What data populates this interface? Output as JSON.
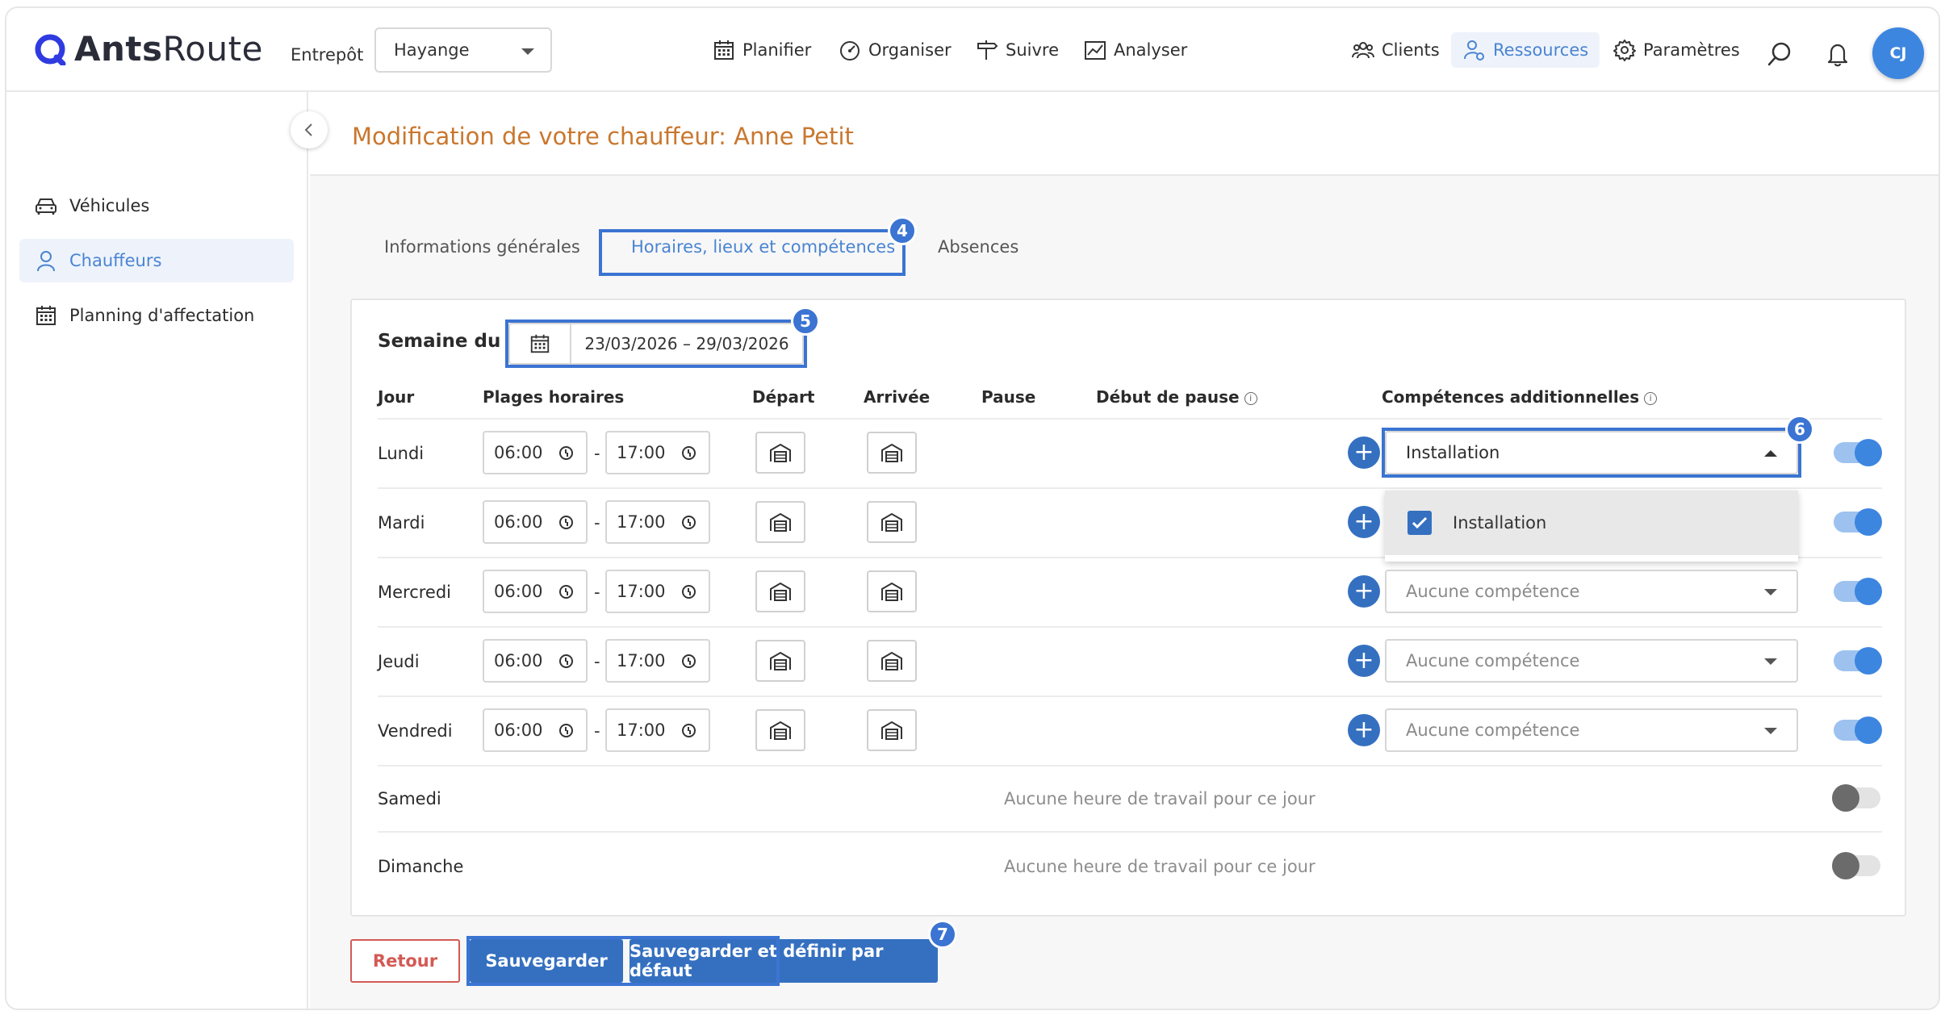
{
  "brand": {
    "name_bold": "Ants",
    "name_light": "Route"
  },
  "header": {
    "warehouse_label": "Entrepôt",
    "warehouse_value": "Hayange",
    "nav": [
      {
        "label": "Planifier",
        "icon": "calendar-icon"
      },
      {
        "label": "Organiser",
        "icon": "gauge-icon"
      },
      {
        "label": "Suivre",
        "icon": "signpost-icon"
      },
      {
        "label": "Analyser",
        "icon": "chart-icon"
      }
    ],
    "right_nav": [
      {
        "label": "Clients",
        "icon": "clients-icon"
      },
      {
        "label": "Ressources",
        "icon": "resources-icon",
        "active": true
      },
      {
        "label": "Paramètres",
        "icon": "gear-icon"
      }
    ],
    "avatar_initials": "CJ"
  },
  "sidebar": {
    "items": [
      {
        "label": "Véhicules",
        "icon": "car-icon"
      },
      {
        "label": "Chauffeurs",
        "icon": "person-icon",
        "active": true
      },
      {
        "label": "Planning d'affectation",
        "icon": "calendar-icon"
      }
    ]
  },
  "page": {
    "title": "Modification de votre chauffeur: Anne Petit",
    "tabs": [
      {
        "label": "Informations générales"
      },
      {
        "label": "Horaires, lieux et compétences",
        "active": true
      },
      {
        "label": "Absences"
      }
    ]
  },
  "schedule": {
    "week_label": "Semaine du",
    "week_range": "23/03/2026 – 29/03/2026",
    "columns": {
      "day": "Jour",
      "ranges": "Plages horaires",
      "departure": "Départ",
      "arrival": "Arrivée",
      "pause": "Pause",
      "pause_start": "Début de pause",
      "skills": "Compétences additionnelles"
    },
    "days": [
      {
        "name": "Lundi",
        "start": "06:00",
        "end": "17:00",
        "skill": "Installation",
        "enabled": true
      },
      {
        "name": "Mardi",
        "start": "06:00",
        "end": "17:00",
        "skill": "",
        "enabled": true
      },
      {
        "name": "Mercredi",
        "start": "06:00",
        "end": "17:00",
        "skill": "Aucune compétence",
        "enabled": true
      },
      {
        "name": "Jeudi",
        "start": "06:00",
        "end": "17:00",
        "skill": "Aucune compétence",
        "enabled": true
      },
      {
        "name": "Vendredi",
        "start": "06:00",
        "end": "17:00",
        "skill": "Aucune compétence",
        "enabled": true
      },
      {
        "name": "Samedi",
        "no_work": "Aucune heure de travail pour ce jour",
        "enabled": false
      },
      {
        "name": "Dimanche",
        "no_work": "Aucune heure de travail pour ce jour",
        "enabled": false
      }
    ],
    "dropdown_option": "Installation",
    "dash": "-"
  },
  "actions": {
    "back": "Retour",
    "save": "Sauvegarder",
    "save_default": "Sauvegarder et définir par défaut"
  },
  "callouts": [
    "4",
    "5",
    "6",
    "7"
  ],
  "colors": {
    "accent": "#3570c0",
    "title": "#c9772e",
    "highlight": "#3b74d2",
    "danger": "#d35a55"
  }
}
